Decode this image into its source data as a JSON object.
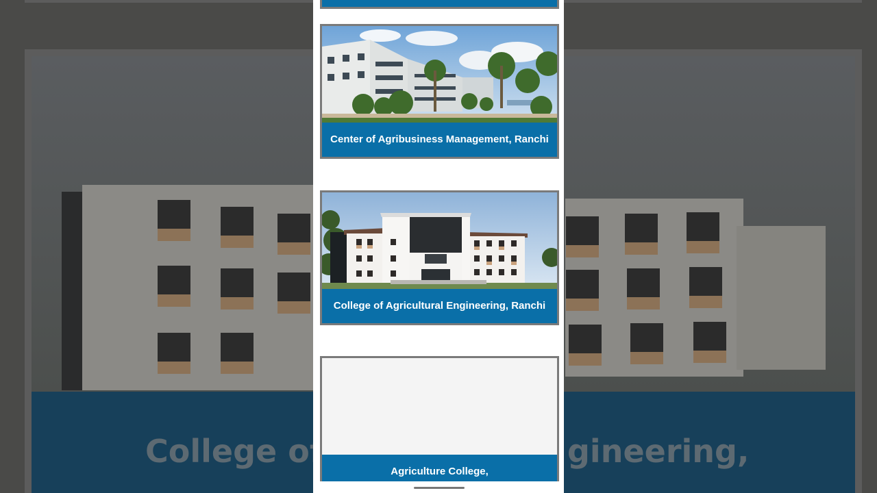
{
  "background": {
    "caption_fragment_left": "College of",
    "caption_fragment_right": "gineering,"
  },
  "cards": [
    {
      "caption": "Center of Agribusiness Management, Ranchi",
      "image": "campus-building-with-palm-trees"
    },
    {
      "caption": "College of Agricultural Engineering, Ranchi",
      "image": "engineering-college-building"
    },
    {
      "caption": "Agriculture College,",
      "image": ""
    }
  ],
  "colors": {
    "caption_band": "#0a6fa8",
    "card_border": "#7a7a7a"
  }
}
